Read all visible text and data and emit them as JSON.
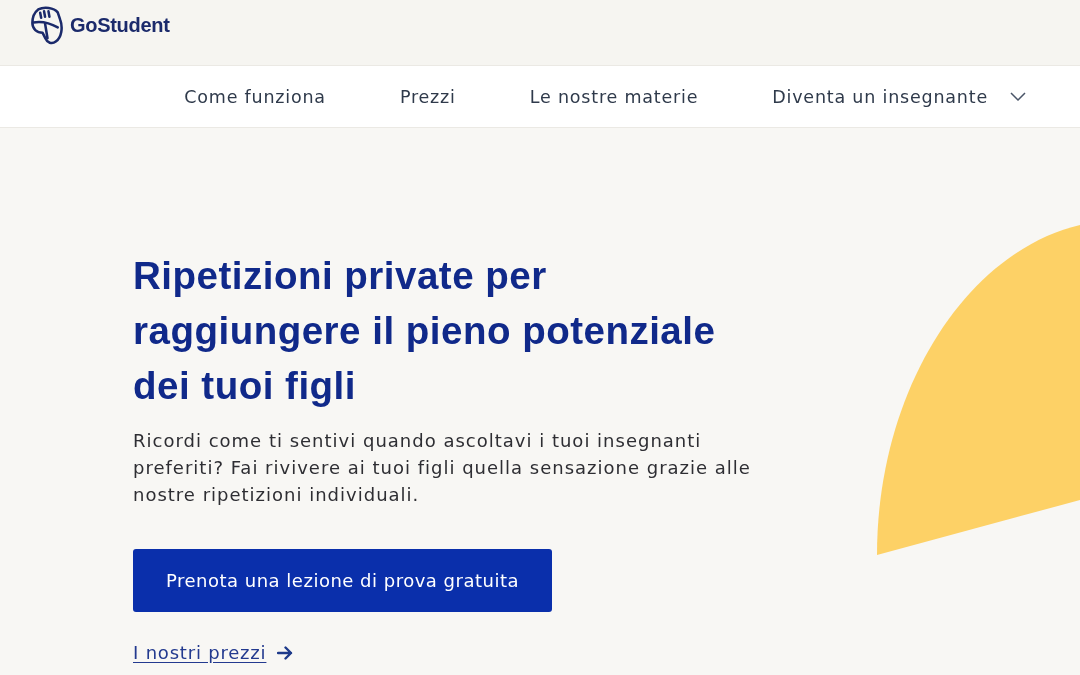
{
  "header": {
    "logo_text": "GoStudent"
  },
  "nav": {
    "items": [
      {
        "label": "Come funziona",
        "has_dropdown": false
      },
      {
        "label": "Prezzi",
        "has_dropdown": false
      },
      {
        "label": "Le nostre materie",
        "has_dropdown": false
      },
      {
        "label": "Diventa un insegnante",
        "has_dropdown": true
      }
    ]
  },
  "hero": {
    "title": "Ripetizioni private per raggiungere il pieno potenziale dei tuoi figli",
    "text": "Ricordi come ti sentivi quando ascoltavi i tuoi insegnanti preferiti? Fai rivivere ai tuoi figli quella sensazione grazie alle nostre ripetizioni individuali.",
    "button": "Prenota una lezione di prova gratuita",
    "link": "I nostri prezzi"
  }
}
